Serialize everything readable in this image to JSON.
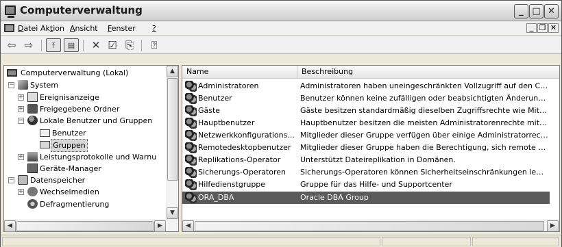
{
  "window": {
    "title": "Computerverwaltung"
  },
  "menu": {
    "items": [
      {
        "pre": "",
        "u": "D",
        "post": "atei"
      },
      {
        "pre": "Ak",
        "u": "t",
        "post": "ion"
      },
      {
        "pre": "",
        "u": "A",
        "post": "nsicht"
      },
      {
        "pre": "",
        "u": "F",
        "post": "enster"
      },
      {
        "pre": "",
        "u": "?",
        "post": ""
      }
    ]
  },
  "toolbar": {
    "icons": [
      "back-arrow-icon",
      "forward-arrow-icon",
      "up-folder-icon",
      "show-tree-icon",
      "delete-icon",
      "properties-icon",
      "export-list-icon",
      "help-icon"
    ]
  },
  "tree": {
    "items": [
      {
        "label": "Computerverwaltung (Lokal)",
        "icon": "computer-icon"
      },
      {
        "label": "System",
        "icon": "system-tools-icon"
      },
      {
        "label": "Ereignisanzeige",
        "icon": "event-viewer-icon"
      },
      {
        "label": "Freigegebene Ordner",
        "icon": "shared-folders-icon"
      },
      {
        "label": "Lokale Benutzer und Gruppen",
        "icon": "local-users-icon"
      },
      {
        "label": "Benutzer",
        "icon": "folder-icon"
      },
      {
        "label": "Gruppen",
        "icon": "folder-open-icon"
      },
      {
        "label": "Leistungsprotokolle und Warnu",
        "icon": "performance-logs-icon"
      },
      {
        "label": "Geräte-Manager",
        "icon": "device-manager-icon"
      },
      {
        "label": "Datenspeicher",
        "icon": "storage-icon"
      },
      {
        "label": "Wechselmedien",
        "icon": "removable-storage-icon"
      },
      {
        "label": "Defragmentierung",
        "icon": "defrag-icon"
      }
    ]
  },
  "list": {
    "columns": {
      "name": "Name",
      "description": "Beschreibung"
    },
    "rows": [
      {
        "name": "Administratoren",
        "description": "Administratoren haben uneingeschränkten Vollzugriff auf den Comp..."
      },
      {
        "name": "Benutzer",
        "description": "Benutzer können keine zufälligen oder beabsichtigten Änderungen ..."
      },
      {
        "name": "Gäste",
        "description": "Gäste besitzen standardmäßig dieselben Zugriffsrechte wie Mitglied..."
      },
      {
        "name": "Hauptbenutzer",
        "description": "Hauptbenutzer besitzen die meisten Administratorenrechte mit einig..."
      },
      {
        "name": "Netzwerkkonfigurations...",
        "description": "Mitglieder dieser Gruppe verfügen über einige Administratorrechte ..."
      },
      {
        "name": "Remotedesktopbenutzer",
        "description": "Mitglieder dieser Gruppe haben die Berechtigung, sich remote anzu..."
      },
      {
        "name": "Replikations-Operator",
        "description": "Unterstützt Dateireplikation in Domänen."
      },
      {
        "name": "Sicherungs-Operatoren",
        "description": "Sicherungs-Operatoren können Sicherheitseinschränkungen lediglic..."
      },
      {
        "name": "Hilfedienstgruppe",
        "description": "Gruppe für das Hilfe- und Supportcenter"
      },
      {
        "name": "ORA_DBA",
        "description": "Oracle DBA Group"
      }
    ]
  }
}
